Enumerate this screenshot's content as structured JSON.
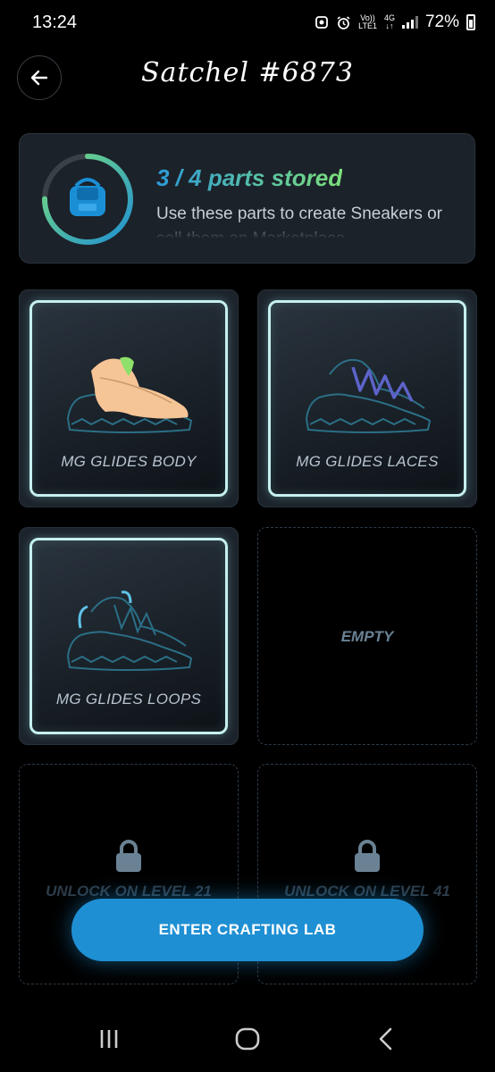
{
  "status_bar": {
    "time": "13:24",
    "network": "4G",
    "volte": "Vo))",
    "lte": "LTE1",
    "battery": "72%"
  },
  "header": {
    "title": "Satchel #6873",
    "back_icon": "arrow-left-icon"
  },
  "storage": {
    "title": "3 / 4 parts stored",
    "description": "Use these parts to create Sneakers or sell them on Marketplace",
    "stored": 3,
    "capacity": 4,
    "icon": "satchel-icon",
    "ring_colors": [
      "#1f8fd3",
      "#7be07a"
    ]
  },
  "slots": [
    {
      "state": "filled",
      "label": "MG GLIDES BODY",
      "part": "body"
    },
    {
      "state": "filled",
      "label": "MG GLIDES LACES",
      "part": "laces"
    },
    {
      "state": "filled",
      "label": "MG GLIDES LOOPS",
      "part": "loops"
    },
    {
      "state": "empty",
      "label": "EMPTY"
    },
    {
      "state": "locked",
      "label": "UNLOCK ON LEVEL 21"
    },
    {
      "state": "locked",
      "label": "UNLOCK ON LEVEL 41"
    }
  ],
  "cta": {
    "label": "ENTER CRAFTING LAB",
    "color": "#1f8fd3"
  },
  "navbar": {
    "recents_icon": "recents-icon",
    "home_icon": "home-icon",
    "back_icon": "back-chevron-icon"
  }
}
